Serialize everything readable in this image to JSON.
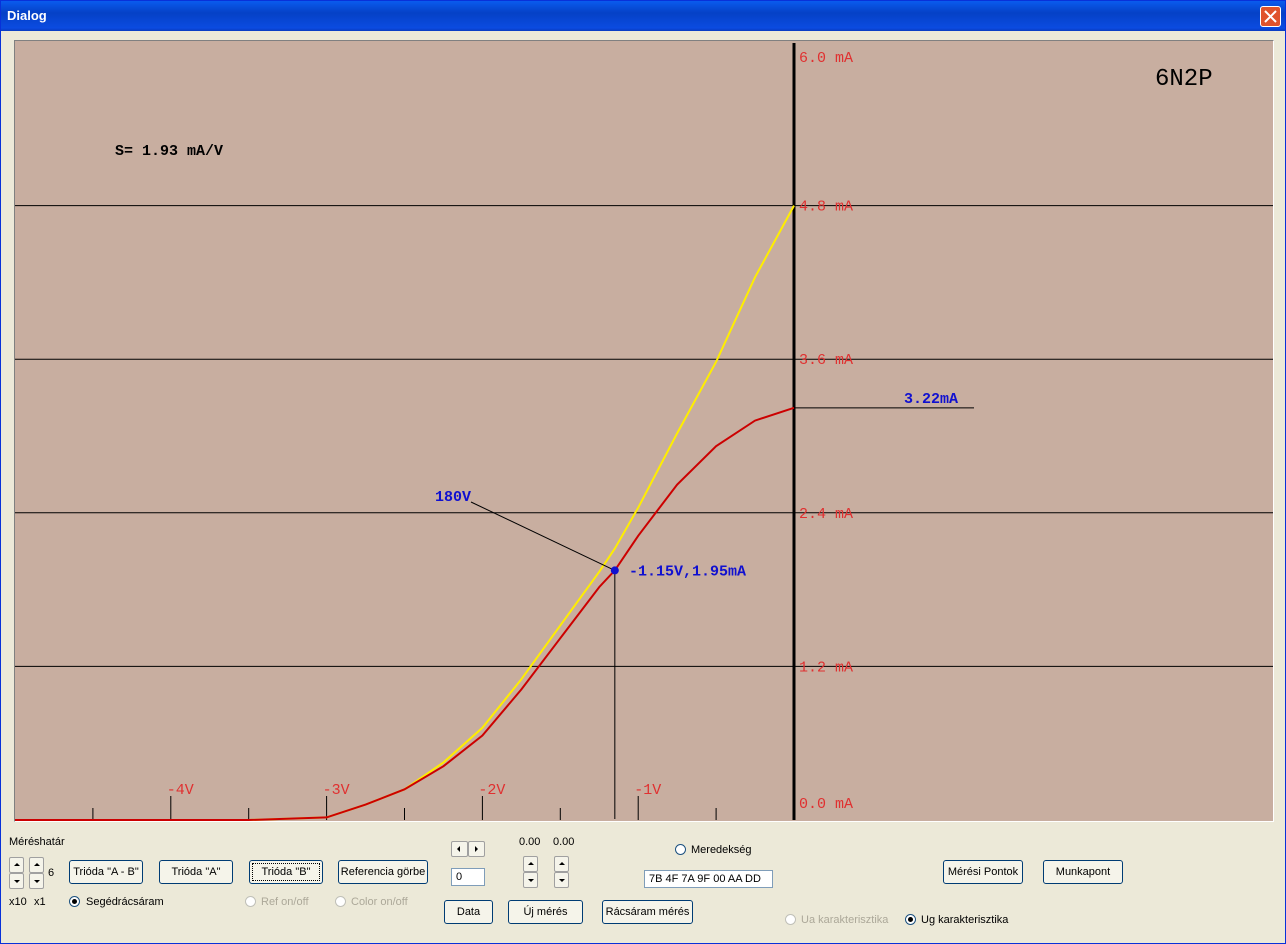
{
  "window": {
    "title": "Dialog"
  },
  "chart": {
    "tube_name": "6N2P",
    "slope": "S= 1.93 mA/V",
    "point_label": "-1.15V,1.95mA",
    "anode_voltage_label": "180V",
    "end_current_label": "3.22mA",
    "y_tick_labels": [
      "0.0 mA",
      "1.2 mA",
      "2.4 mA",
      "3.6 mA",
      "4.8 mA",
      "6.0 mA"
    ],
    "x_tick_labels": [
      "-4V",
      "-3V",
      "-2V",
      "-1V"
    ],
    "colors": {
      "background": "#c8aea0",
      "measured": "#cc0000",
      "reference": "#ffee00",
      "labels": "#e03030",
      "annotation": "#1010d0"
    }
  },
  "chart_data": {
    "type": "line",
    "title": "6N2P",
    "xlabel": "",
    "ylabel": "",
    "xlim": [
      -5.0,
      0.0
    ],
    "ylim": [
      0.0,
      6.0
    ],
    "x_ticks": [
      -4,
      -3,
      -2,
      -1
    ],
    "y_ticks": [
      0.0,
      1.2,
      2.4,
      3.6,
      4.8,
      6.0
    ],
    "grid": true,
    "series": [
      {
        "color": "#cc0000",
        "x": [
          -5.0,
          -4.2,
          -3.5,
          -3.0,
          -2.75,
          -2.5,
          -2.25,
          -2.0,
          -1.75,
          -1.5,
          -1.25,
          -1.15,
          -1.0,
          -0.75,
          -0.5,
          -0.25,
          0.0
        ],
        "y": [
          0.0,
          0.0,
          0.0,
          0.02,
          0.12,
          0.24,
          0.42,
          0.66,
          1.02,
          1.42,
          1.82,
          1.95,
          2.22,
          2.62,
          2.92,
          3.12,
          3.22
        ]
      },
      {
        "color": "#ffee00",
        "x": [
          -5.0,
          -4.2,
          -3.5,
          -3.0,
          -2.75,
          -2.5,
          -2.25,
          -2.0,
          -1.75,
          -1.5,
          -1.25,
          -1.15,
          -1.0,
          -0.75,
          -0.5,
          -0.25,
          0.0
        ],
        "y": [
          0.0,
          0.0,
          0.0,
          0.02,
          0.12,
          0.24,
          0.45,
          0.72,
          1.1,
          1.52,
          1.94,
          2.12,
          2.44,
          3.02,
          3.58,
          4.24,
          4.8
        ]
      }
    ],
    "marker": {
      "x": -1.15,
      "y": 1.95
    },
    "end_value": 3.22
  },
  "controls": {
    "range_label": "Méréshatár",
    "range_value": "6",
    "x10_label": "x10",
    "x1_label": "x1",
    "grid_current_label": "Segédrácsáram",
    "btn_trioda_ab": "Trióda \"A - B\"",
    "btn_trioda_a": "Trióda  \"A\"",
    "btn_trioda_b": "Trióda  \"B\"",
    "btn_reference": "Referencia görbe",
    "ref_onoff": "Ref on/off",
    "color_onoff": "Color on/off",
    "step_value": "0",
    "val1": "0.00",
    "val2": "0.00",
    "btn_data": "Data",
    "btn_new": "Új mérés",
    "btn_grid_meas": "Rácsáram mérés",
    "slope_label": "Meredekség",
    "hex_value": "7B 4F 7A 9F 00 AA DD",
    "ua_label": "Ua karakterisztika",
    "ug_label": "Ug karakterisztika",
    "btn_points": "Mérési Pontok",
    "btn_workpoint": "Munkapont"
  }
}
